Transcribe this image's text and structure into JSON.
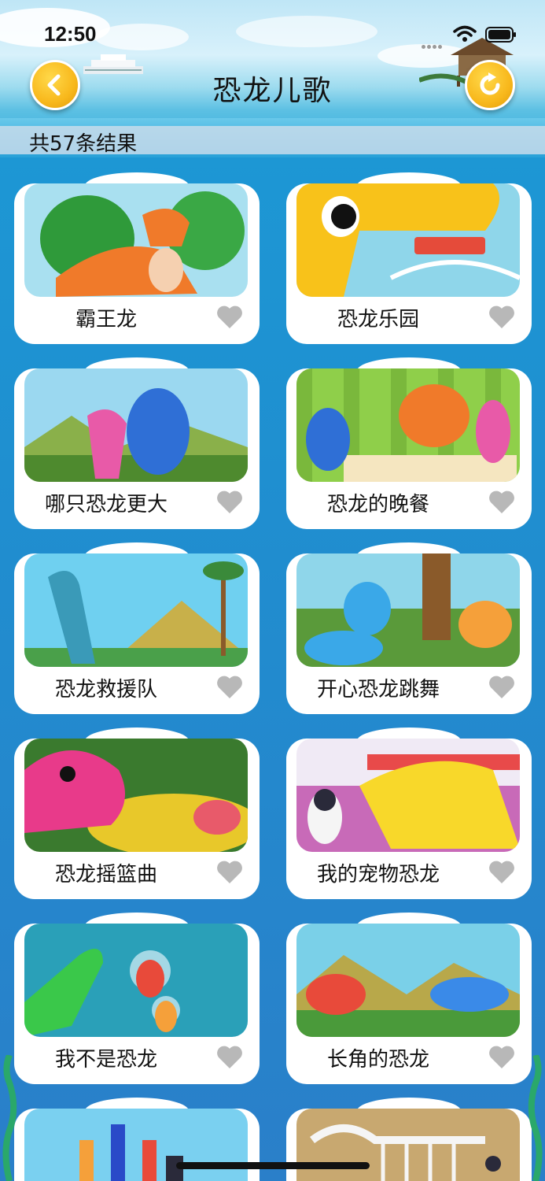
{
  "status": {
    "time": "12:50"
  },
  "header": {
    "title": "恐龙儿歌"
  },
  "results": {
    "summary": "共57条结果"
  },
  "cards": [
    {
      "title": "霸王龙"
    },
    {
      "title": "恐龙乐园"
    },
    {
      "title": "哪只恐龙更大"
    },
    {
      "title": "恐龙的晚餐"
    },
    {
      "title": "恐龙救援队"
    },
    {
      "title": "开心恐龙跳舞"
    },
    {
      "title": "恐龙摇篮曲"
    },
    {
      "title": "我的宠物恐龙"
    },
    {
      "title": "我不是恐龙"
    },
    {
      "title": "长角的恐龙"
    }
  ],
  "colors": {
    "accent": "#f8b81c",
    "heart": "#b8b8b8",
    "background": "#1f8fd0"
  },
  "icons": {
    "back": "chevron-left-icon",
    "refresh": "refresh-icon",
    "favorite": "heart-icon"
  }
}
